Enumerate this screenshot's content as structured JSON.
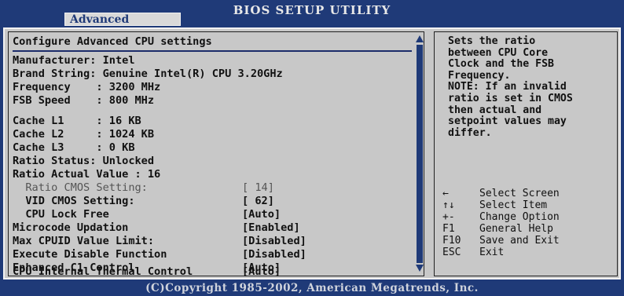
{
  "header": {
    "title": "BIOS SETUP UTILITY",
    "active_tab": "Advanced"
  },
  "main": {
    "section_title": "Configure Advanced CPU settings",
    "info": [
      "Manufacturer: Intel",
      "Brand String: Genuine Intel(R) CPU 3.20GHz",
      "Frequency    : 3200 MHz",
      "FSB Speed    : 800 MHz"
    ],
    "cache": [
      "Cache L1     : 16 KB",
      "Cache L2     : 1024 KB",
      "Cache L3     : 0 KB",
      "Ratio Status: Unlocked",
      "Ratio Actual Value : 16"
    ],
    "settings": [
      {
        "label": "  Ratio CMOS Setting:",
        "value": "[ 14]",
        "dimmed": true
      },
      {
        "label": "  VID CMOS Setting:",
        "value": "[ 62]",
        "dimmed": false
      },
      {
        "label": "  CPU Lock Free",
        "value": "[Auto]",
        "dimmed": false
      },
      {
        "label": "Microcode Updation",
        "value": "[Enabled]",
        "dimmed": false
      },
      {
        "label": "Max CPUID Value Limit:",
        "value": "[Disabled]",
        "dimmed": false
      },
      {
        "label": "Execute Disable Function",
        "value": "[Disabled]",
        "dimmed": false
      },
      {
        "label": "Enhanced C1 Control",
        "value": "[Auto]",
        "dimmed": false
      },
      {
        "label": "CPU Internal Thermal Control",
        "value": "[Auto]",
        "dimmed": false
      }
    ]
  },
  "help": {
    "text": "Sets the ratio\nbetween CPU Core\nClock and the FSB\nFrequency.\nNOTE: If an invalid\nratio is set in CMOS\nthen actual and\nsetpoint values may\ndiffer.",
    "keys": [
      {
        "key": "←",
        "desc": "Select Screen",
        "icon": "arrow-left-icon"
      },
      {
        "key": "↑↓",
        "desc": "Select Item",
        "icon": "arrow-updown-icon"
      },
      {
        "key": "+-",
        "desc": "Change Option"
      },
      {
        "key": "F1",
        "desc": "General Help"
      },
      {
        "key": "F10",
        "desc": "Save and Exit"
      },
      {
        "key": "ESC",
        "desc": "Exit"
      }
    ]
  },
  "footer": {
    "copyright": "(C)Copyright 1985-2002, American Megatrends, Inc."
  },
  "colors": {
    "background": "#1f3a78",
    "panel": "#c8c8c8",
    "text": "#111111",
    "dimmed": "#555555"
  }
}
